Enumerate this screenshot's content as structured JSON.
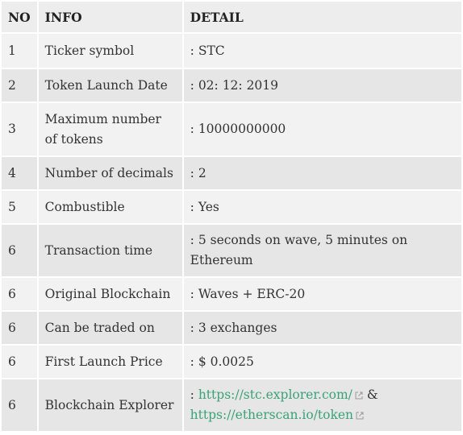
{
  "headers": {
    "no": "NO",
    "info": "INFO",
    "detail": "DETAIL"
  },
  "rows": [
    {
      "no": "1",
      "info": "Ticker symbol",
      "detail": ": STC"
    },
    {
      "no": "2",
      "info": "Token Launch Date",
      "detail": ": 02: 12: 2019"
    },
    {
      "no": "3",
      "info": "Maximum number of tokens",
      "detail": ": 10000000000"
    },
    {
      "no": "4",
      "info": "Number of decimals",
      "detail": ": 2"
    },
    {
      "no": "5",
      "info": "Combustible",
      "detail": ": Yes"
    },
    {
      "no": "6",
      "info": "Transaction time",
      "detail": ": 5 seconds on wave, 5 minutes on Ethereum"
    },
    {
      "no": "6",
      "info": "Original Blockchain",
      "detail": ": Waves + ERC-20"
    },
    {
      "no": "6",
      "info": "Can be traded on",
      "detail": ": 3 exchanges"
    },
    {
      "no": "6",
      "info": "First Launch Price",
      "detail": ": $ 0.0025"
    },
    {
      "no": "6",
      "info": "Blockchain Explorer",
      "detail_prefix": ": ",
      "link1": "https://stc.explorer.com/",
      "separator": " & ",
      "link2": "https://etherscan.io/token"
    }
  ],
  "colors": {
    "link": "#3aa27a",
    "row_odd": "#f2f2f2",
    "row_even": "#e6e6e6",
    "header": "#ededed"
  },
  "icons": {
    "external_link": "external-link-icon"
  }
}
